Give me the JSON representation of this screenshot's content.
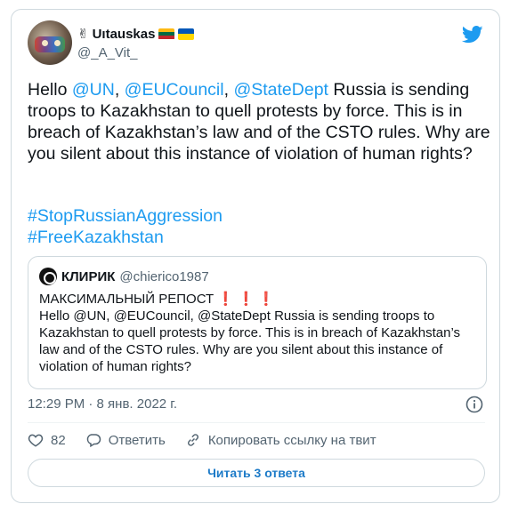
{
  "tweet": {
    "author": {
      "display_name": "Uıtauskas",
      "name_prefix_emoji": "✌",
      "flags": [
        "lithuania-flag",
        "ukraine-flag"
      ],
      "handle": "@_A_Vit_"
    },
    "text": {
      "hello": "Hello ",
      "mention1": "@UN",
      "sep1": ", ",
      "mention2": "@EUCouncil",
      "sep2": ", ",
      "mention3": "@StateDept",
      "rest": " Russia is sending troops to Kazakhstan to quell protests by force. This is in breach of Kazakhstan’s law and of the CSTO rules. Why are you silent about this instance of violation of human rights?"
    },
    "hashtags": [
      "#StopRussianAggression",
      "#FreeKazakhstan"
    ],
    "quoted": {
      "name": "КЛИРИК",
      "handle": "@chierico1987",
      "title": "МАКСИМАЛЬНЫЙ РЕПОСТ",
      "exclamations": "❗❗❗",
      "body": "Hello @UN, @EUCouncil, @StateDept Russia is sending troops to Kazakhstan to quell protests by force. This is in breach of Kazakhstan’s law and of the CSTO rules. Why are you silent about this instance of violation of human rights?"
    },
    "timestamp": "12:29 PM · 8 янв. 2022 г.",
    "actions": {
      "like_count": "82",
      "reply_label": "Ответить",
      "copy_link_label": "Копировать ссылку на твит"
    },
    "read_replies_label": "Читать 3 ответа"
  },
  "colors": {
    "accent": "#1d9bf0",
    "border": "#cfd9de",
    "muted": "#536471",
    "text": "#0f1419"
  }
}
